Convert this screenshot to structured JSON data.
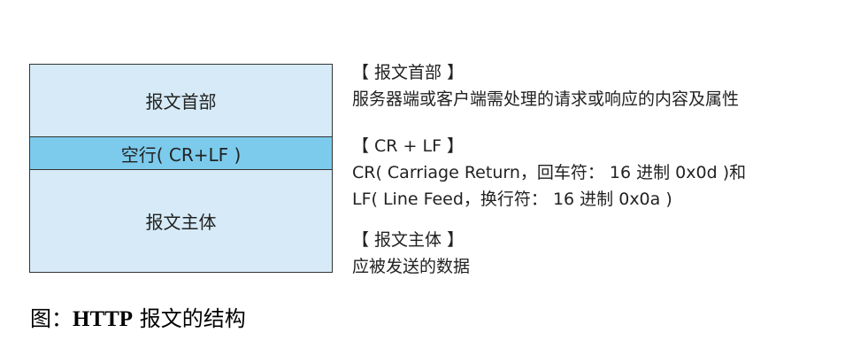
{
  "diagram": {
    "header_block": "报文首部",
    "crlf_block": "空行( CR+LF )",
    "body_block": "报文主体",
    "colors": {
      "light_block": "#d6ebf7",
      "crlf_block": "#7ccbec",
      "border": "#333333"
    }
  },
  "descriptions": {
    "header": {
      "title": "【 报文首部 】",
      "lines": [
        "服务器端或客户端需处理的请求或响应的内容及属性"
      ]
    },
    "crlf": {
      "title": "【 CR + LF 】",
      "lines": [
        "CR( Carriage Return，回车符： 16 进制 0x0d )和",
        "LF( Line Feed，换行符： 16 进制 0x0a )"
      ]
    },
    "body": {
      "title": "【 报文主体 】",
      "lines": [
        "应被发送的数据"
      ]
    }
  },
  "caption": {
    "prefix": "图：",
    "bold": "HTTP",
    "suffix": " 报文的结构"
  }
}
